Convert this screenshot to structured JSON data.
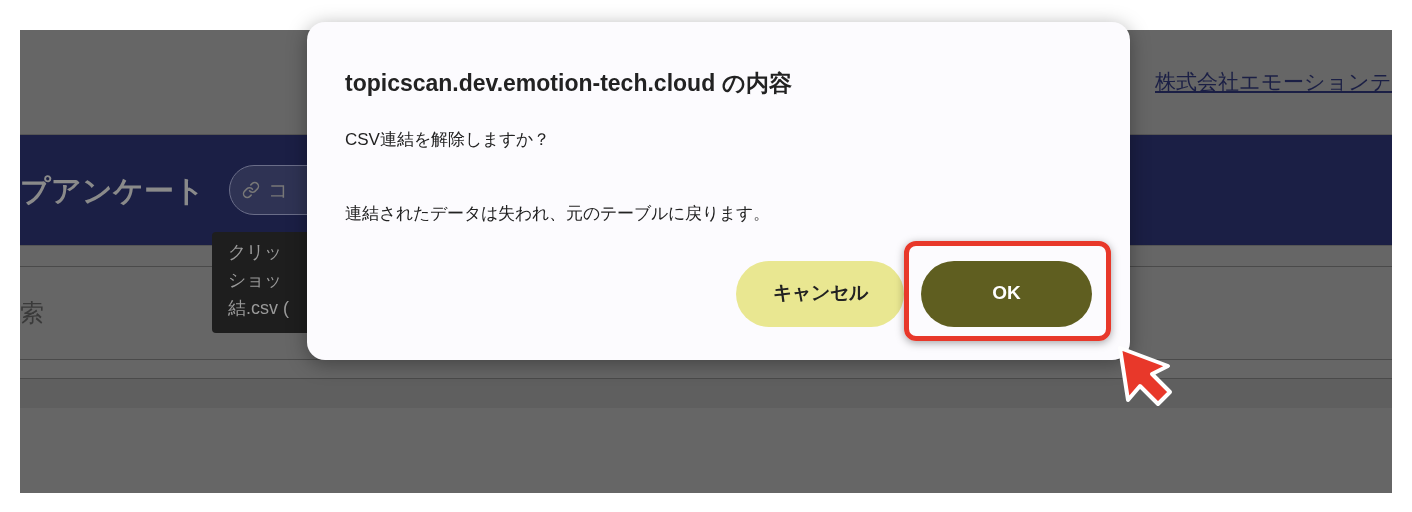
{
  "page": {
    "company_link": "株式会社エモーションテ",
    "title": "プアンケート",
    "pill_label": "コ",
    "tooltip_lines": [
      "クリッ",
      "ショッ",
      "結.csv ("
    ],
    "search_label": "索"
  },
  "dialog": {
    "title": "topicscan.dev.emotion-tech.cloud の内容",
    "message_lines": [
      "CSV連結を解除しますか？",
      "連結されたデータは失われ、元のテーブルに戻ります。"
    ],
    "buttons": [
      {
        "label": "キャンセル",
        "kind": "cancel",
        "highlighted": false
      },
      {
        "label": "OK",
        "kind": "primary",
        "highlighted": true
      }
    ]
  }
}
